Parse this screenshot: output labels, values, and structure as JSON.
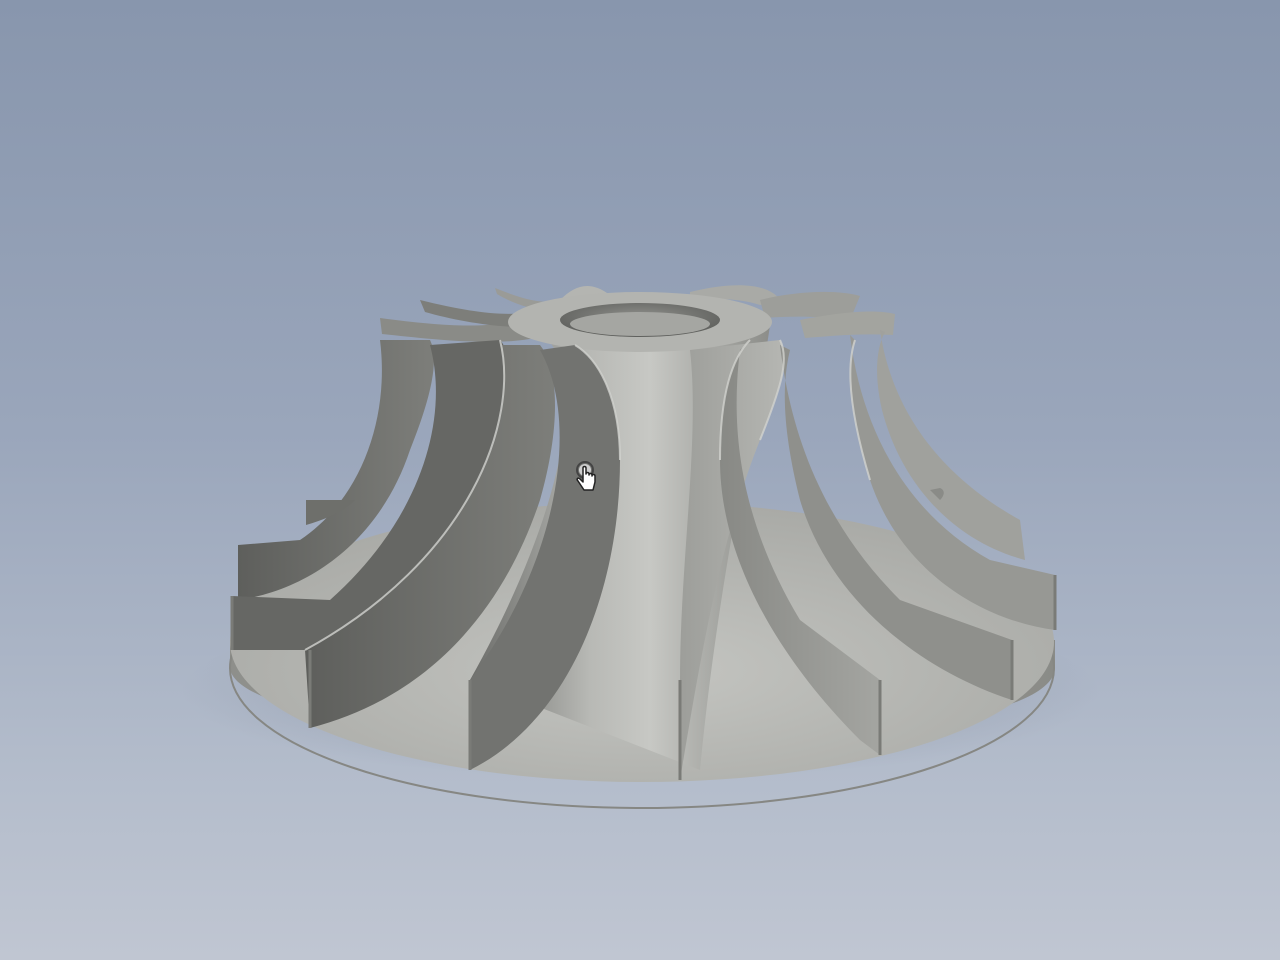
{
  "viewport": {
    "background_top": "#8896ad",
    "background_bottom": "#c0c6d2"
  },
  "model": {
    "part_type": "impeller",
    "blade_count": 14,
    "metal_color": "#9a9b97",
    "metal_dark": "#5c5d5a",
    "metal_light": "#c9cac6"
  },
  "cursor": {
    "icon": "hand-pointer-icon"
  }
}
